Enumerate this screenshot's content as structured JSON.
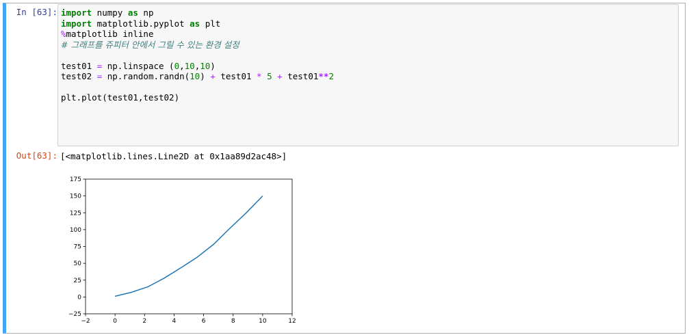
{
  "cell": {
    "in_prompt": "In [63]:",
    "out_prompt": "Out[63]:",
    "output_text": "[<matplotlib.lines.Line2D at 0x1aa89d2ac48>]",
    "code": {
      "line1": {
        "kw1": "import",
        "mid": " numpy ",
        "kw2": "as",
        "tail": " np"
      },
      "line2": {
        "kw1": "import",
        "mid": " matplotlib.pyplot ",
        "kw2": "as",
        "tail": " plt"
      },
      "line3": {
        "pct": "%",
        "rest": "matplotlib inline"
      },
      "line4": {
        "comment": "# 그래프를 쥬피터 안에서 그릴 수 있는 환경 설정"
      },
      "line5": {
        "a": "test01 ",
        "eq": "=",
        "b": " np.linspace (",
        "n1": "0",
        "c1": ",",
        "n2": "10",
        "c2": ",",
        "n3": "10",
        "e": ")"
      },
      "line6": {
        "a": "test02 ",
        "eq": "=",
        "b": " np.random.randn(",
        "n1": "10",
        "c": ") ",
        "p1": "+",
        "d": " test01 ",
        "m": "*",
        "sp": " ",
        "n2": "5",
        "sp2": " ",
        "p2": "+",
        "f": " test01",
        "pw": "**",
        "n3": "2"
      },
      "line7": {
        "text": "plt.plot(test01,test02)"
      }
    }
  },
  "colors": {
    "accent": "#42a5f5",
    "line": "#1f77b4",
    "in_prompt": "#303f9f",
    "out_prompt": "#d84315"
  },
  "chart_data": {
    "type": "line",
    "x": [
      0,
      1.11,
      2.22,
      3.33,
      4.44,
      5.56,
      6.67,
      7.78,
      8.89,
      10
    ],
    "values": [
      1,
      7,
      15,
      28,
      43,
      59,
      78,
      102,
      125,
      150
    ],
    "xlim": [
      -2,
      12
    ],
    "ylim": [
      -25,
      175
    ],
    "xticks": [
      -2,
      0,
      2,
      4,
      6,
      8,
      10,
      12
    ],
    "yticks": [
      -25,
      0,
      25,
      50,
      75,
      100,
      125,
      150,
      175
    ],
    "xtick_labels": [
      "−2",
      "0",
      "2",
      "4",
      "6",
      "8",
      "10",
      "12"
    ],
    "ytick_labels": [
      "−25",
      "0",
      "25",
      "50",
      "75",
      "100",
      "125",
      "150",
      "175"
    ],
    "title": "",
    "xlabel": "",
    "ylabel": "",
    "grid": false
  }
}
